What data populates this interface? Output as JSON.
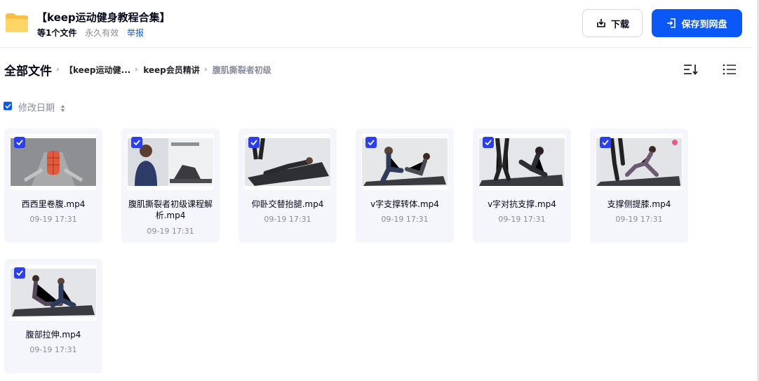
{
  "header": {
    "title": "【keep运动健身教程合集】",
    "file_count": "等1个文件",
    "validity": "永久有效",
    "report": "举报",
    "download_label": "下载",
    "save_label": "保存到网盘"
  },
  "breadcrumb": {
    "root": "全部文件",
    "items": [
      "【keep运动健...",
      "keep会员精讲",
      "腹肌撕裂者初级"
    ]
  },
  "sort": {
    "label": "修改日期"
  },
  "files": [
    {
      "name": "西西里卷腹.mp4",
      "date": "09-19 17:31"
    },
    {
      "name": "腹肌撕裂者初级课程解析.mp4",
      "date": "09-19 17:31"
    },
    {
      "name": "仰卧交替抬腿.mp4",
      "date": "09-19 17:31"
    },
    {
      "name": "v字支撑转体.mp4",
      "date": "09-19 17:31"
    },
    {
      "name": "v字对抗支撑.mp4",
      "date": "09-19 17:31"
    },
    {
      "name": "支撑侧提膝.mp4",
      "date": "09-19 17:31"
    },
    {
      "name": "腹部拉伸.mp4",
      "date": "09-19 17:31"
    }
  ],
  "colors": {
    "accent": "#0a59f7",
    "checkbox": "#2b3fef",
    "card_bg": "#f5f6fc",
    "muted": "#878c9c"
  },
  "icons": [
    "folder-icon",
    "download-icon",
    "save-icon",
    "sort-icon",
    "list-view-icon",
    "check-icon"
  ]
}
